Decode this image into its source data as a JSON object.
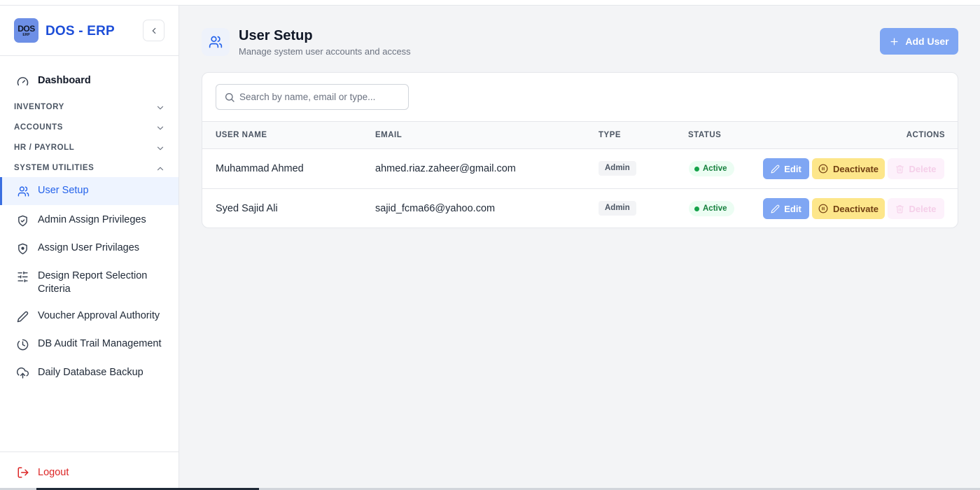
{
  "app": {
    "logo_text": "DOS",
    "logo_sub": "ERP",
    "title": "DOS - ERP"
  },
  "sidebar": {
    "dashboard": "Dashboard",
    "sections": {
      "inventory": "INVENTORY",
      "accounts": "ACCOUNTS",
      "hr": "HR / PAYROLL",
      "system": "SYSTEM UTILITIES"
    },
    "items": [
      {
        "label": "User Setup",
        "icon": "users-icon",
        "active": true
      },
      {
        "label": "Admin Assign Privileges",
        "icon": "shield-check-icon"
      },
      {
        "label": "Assign User Privilages",
        "icon": "shield-icon"
      },
      {
        "label": "Design Report Selection Criteria",
        "icon": "sliders-icon"
      },
      {
        "label": "Voucher Approval Authority",
        "icon": "pen-icon"
      },
      {
        "label": "DB Audit Trail Management",
        "icon": "history-icon"
      },
      {
        "label": "Daily Database Backup",
        "icon": "cloud-upload-icon"
      }
    ],
    "logout": "Logout"
  },
  "header": {
    "title": "User Setup",
    "subtitle": "Manage system user accounts and access",
    "add_button": "Add User"
  },
  "search": {
    "placeholder": "Search by name, email or type..."
  },
  "table": {
    "columns": {
      "name": "USER NAME",
      "email": "EMAIL",
      "type": "TYPE",
      "status": "STATUS",
      "actions": "ACTIONS"
    },
    "rows": [
      {
        "name": "Muhammad Ahmed",
        "email": "ahmed.riaz.zaheer@gmail.com",
        "type": "Admin",
        "status": "Active"
      },
      {
        "name": "Syed Sajid Ali",
        "email": "sajid_fcma66@yahoo.com",
        "type": "Admin",
        "status": "Active"
      }
    ],
    "actions": {
      "edit": "Edit",
      "deactivate": "Deactivate",
      "delete": "Delete"
    }
  },
  "colors": {
    "accent": "#2563eb",
    "brand": "#1d4ed8",
    "status_active": "#15803d",
    "logout": "#dc2626"
  }
}
